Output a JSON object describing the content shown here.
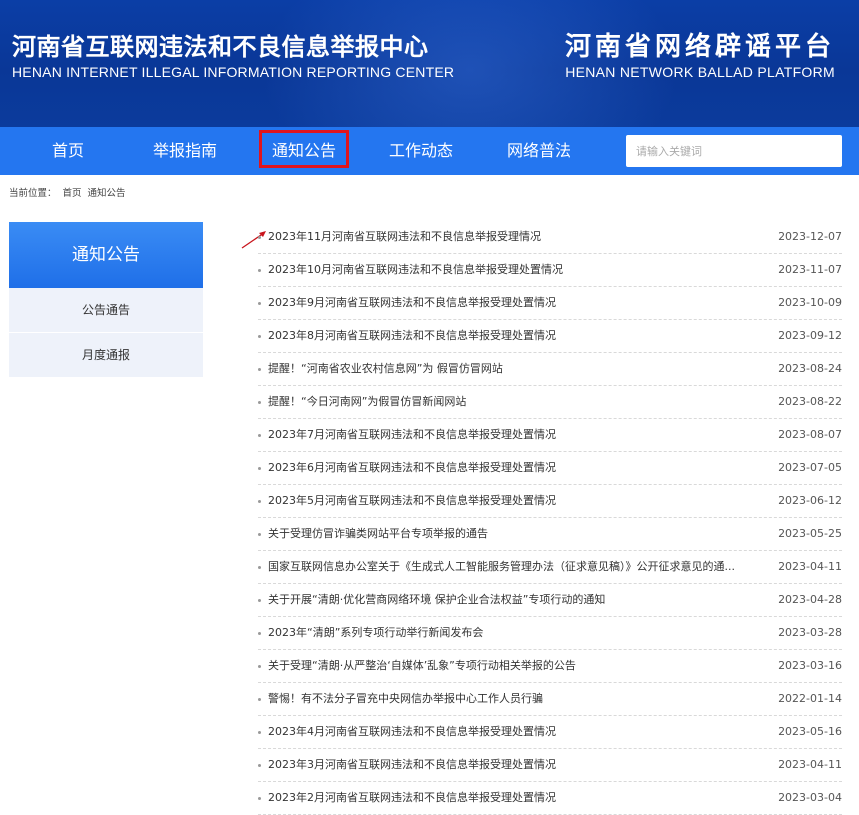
{
  "header": {
    "left_cn": "河南省互联网违法和不良信息举报中心",
    "left_en": "HENAN INTERNET ILLEGAL INFORMATION REPORTING CENTER",
    "right_cn": "河南省网络辟谣平台",
    "right_en": "HENAN NETWORK BALLAD PLATFORM"
  },
  "nav": {
    "items": [
      "首页",
      "举报指南",
      "通知公告",
      "工作动态",
      "网络普法"
    ],
    "active_index": 2,
    "search_placeholder": "请输入关键词"
  },
  "breadcrumb": {
    "label": "当前位置：",
    "items": [
      "首页",
      "通知公告"
    ]
  },
  "sidebar": {
    "title": "通知公告",
    "items": [
      "公告通告",
      "月度通报"
    ]
  },
  "list": [
    {
      "title": "2023年11月河南省互联网违法和不良信息举报受理情况",
      "date": "2023-12-07"
    },
    {
      "title": "2023年10月河南省互联网违法和不良信息举报受理处置情况",
      "date": "2023-11-07"
    },
    {
      "title": "2023年9月河南省互联网违法和不良信息举报受理处置情况",
      "date": "2023-10-09"
    },
    {
      "title": "2023年8月河南省互联网违法和不良信息举报受理处置情况",
      "date": "2023-09-12"
    },
    {
      "title": "提醒！“河南省农业农村信息网”为 假冒仿冒网站",
      "date": "2023-08-24"
    },
    {
      "title": "提醒！“今日河南网”为假冒仿冒新闻网站",
      "date": "2023-08-22"
    },
    {
      "title": "2023年7月河南省互联网违法和不良信息举报受理处置情况",
      "date": "2023-08-07"
    },
    {
      "title": "2023年6月河南省互联网违法和不良信息举报受理处置情况",
      "date": "2023-07-05"
    },
    {
      "title": "2023年5月河南省互联网违法和不良信息举报受理处置情况",
      "date": "2023-06-12"
    },
    {
      "title": "关于受理仿冒诈骗类网站平台专项举报的通告",
      "date": "2023-05-25"
    },
    {
      "title": "国家互联网信息办公室关于《生成式人工智能服务管理办法（征求意见稿）》公开征求意见的通...",
      "date": "2023-04-11"
    },
    {
      "title": "关于开展“清朗·优化营商网络环境 保护企业合法权益”专项行动的通知",
      "date": "2023-04-28"
    },
    {
      "title": "2023年“清朗”系列专项行动举行新闻发布会",
      "date": "2023-03-28"
    },
    {
      "title": "关于受理“清朗·从严整治‘自媒体’乱象”专项行动相关举报的公告",
      "date": "2023-03-16"
    },
    {
      "title": "警惕！有不法分子冒充中央网信办举报中心工作人员行骗",
      "date": "2022-01-14"
    },
    {
      "title": "2023年4月河南省互联网违法和不良信息举报受理处置情况",
      "date": "2023-05-16"
    },
    {
      "title": "2023年3月河南省互联网违法和不良信息举报受理处置情况",
      "date": "2023-04-11"
    },
    {
      "title": "2023年2月河南省互联网违法和不良信息举报受理处置情况",
      "date": "2023-03-04"
    }
  ],
  "colors": {
    "banner": "#0a3797",
    "nav": "#2476f0",
    "highlight": "#e1141c"
  }
}
